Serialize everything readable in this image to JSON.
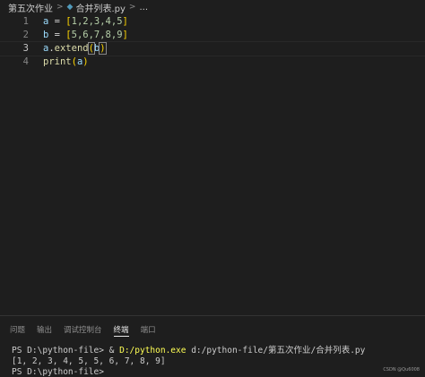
{
  "breadcrumb": {
    "folder": "第五次作业",
    "file": "合并列表.py",
    "more": "...",
    "separator": ">",
    "file_icon": "python-file-icon"
  },
  "editor": {
    "lines": [
      {
        "number": "1",
        "tokens": [
          "a",
          " = ",
          "[",
          "1,2,3,4,5",
          "]"
        ]
      },
      {
        "number": "2",
        "tokens": [
          "b",
          " = ",
          "[",
          "5,6,7,8,9",
          "]"
        ]
      },
      {
        "number": "3",
        "tokens": [
          "a",
          ".",
          "extend",
          "(",
          "b",
          ")"
        ]
      },
      {
        "number": "4",
        "tokens": [
          "print",
          "(",
          "a",
          ")"
        ]
      }
    ],
    "current_line": 3
  },
  "panel": {
    "tabs": [
      "问题",
      "输出",
      "调试控制台",
      "终端",
      "端口"
    ],
    "active_tab": "终端",
    "terminal": {
      "line1_prompt": "PS D:\\python-file> & ",
      "line1_exe": "D:/python.exe",
      "line1_arg": " d:/python-file/第五次作业/合并列表.py",
      "line2": "[1, 2, 3, 4, 5, 5, 6, 7, 8, 9]",
      "line3": "PS D:\\python-file> "
    }
  },
  "watermark": "CSDN @Qu6008",
  "colors": {
    "background": "#1e1e1e",
    "variable": "#9cdcfe",
    "number": "#b5cea8",
    "function": "#dcdcaa",
    "bracket1": "#ffd700",
    "bracket2": "#da70d6"
  }
}
